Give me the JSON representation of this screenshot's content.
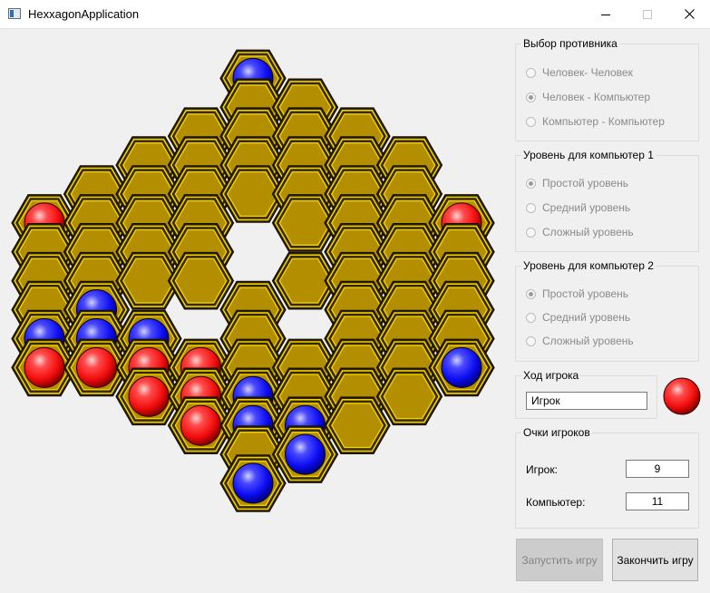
{
  "window": {
    "title": "HexxagonApplication"
  },
  "colors": {
    "board_fill": "#b38f00",
    "player_red": "#ff1a1a",
    "player_blue": "#1a1aff",
    "background": "#f0f0f0"
  },
  "board": {
    "cells": [
      {
        "col": 0,
        "row": 6,
        "piece": "red"
      },
      {
        "col": 0,
        "row": 7,
        "piece": "empty"
      },
      {
        "col": 0,
        "row": 8,
        "piece": "empty"
      },
      {
        "col": 0,
        "row": 9,
        "piece": "empty"
      },
      {
        "col": 0,
        "row": 10,
        "piece": "blue"
      },
      {
        "col": 0,
        "row": 11,
        "piece": "red"
      },
      {
        "col": 1,
        "row": 5,
        "piece": "empty"
      },
      {
        "col": 1,
        "row": 6,
        "piece": "empty"
      },
      {
        "col": 1,
        "row": 7,
        "piece": "empty"
      },
      {
        "col": 1,
        "row": 8,
        "piece": "empty"
      },
      {
        "col": 1,
        "row": 9,
        "piece": "blue"
      },
      {
        "col": 1,
        "row": 10,
        "piece": "blue"
      },
      {
        "col": 1,
        "row": 11,
        "piece": "red"
      },
      {
        "col": 2,
        "row": 4,
        "piece": "empty"
      },
      {
        "col": 2,
        "row": 5,
        "piece": "empty"
      },
      {
        "col": 2,
        "row": 6,
        "piece": "empty"
      },
      {
        "col": 2,
        "row": 7,
        "piece": "empty"
      },
      {
        "col": 2,
        "row": 8,
        "piece": "empty"
      },
      {
        "col": 2,
        "row": 10,
        "piece": "blue"
      },
      {
        "col": 2,
        "row": 11,
        "piece": "red"
      },
      {
        "col": 2,
        "row": 12,
        "piece": "red"
      },
      {
        "col": 3,
        "row": 3,
        "piece": "empty"
      },
      {
        "col": 3,
        "row": 4,
        "piece": "empty"
      },
      {
        "col": 3,
        "row": 5,
        "piece": "empty"
      },
      {
        "col": 3,
        "row": 6,
        "piece": "empty"
      },
      {
        "col": 3,
        "row": 7,
        "piece": "empty"
      },
      {
        "col": 3,
        "row": 8,
        "piece": "empty"
      },
      {
        "col": 3,
        "row": 11,
        "piece": "red"
      },
      {
        "col": 3,
        "row": 12,
        "piece": "red"
      },
      {
        "col": 3,
        "row": 13,
        "piece": "red"
      },
      {
        "col": 4,
        "row": 1,
        "piece": "blue"
      },
      {
        "col": 4,
        "row": 2,
        "piece": "empty"
      },
      {
        "col": 4,
        "row": 3,
        "piece": "empty"
      },
      {
        "col": 4,
        "row": 4,
        "piece": "empty"
      },
      {
        "col": 4,
        "row": 5,
        "piece": "empty"
      },
      {
        "col": 4,
        "row": 9,
        "piece": "empty"
      },
      {
        "col": 4,
        "row": 10,
        "piece": "empty"
      },
      {
        "col": 4,
        "row": 11,
        "piece": "empty"
      },
      {
        "col": 4,
        "row": 12,
        "piece": "blue"
      },
      {
        "col": 4,
        "row": 13,
        "piece": "blue"
      },
      {
        "col": 4,
        "row": 14,
        "piece": "empty"
      },
      {
        "col": 4,
        "row": 15,
        "piece": "blue"
      },
      {
        "col": 5,
        "row": 2,
        "piece": "empty"
      },
      {
        "col": 5,
        "row": 3,
        "piece": "empty"
      },
      {
        "col": 5,
        "row": 4,
        "piece": "empty"
      },
      {
        "col": 5,
        "row": 5,
        "piece": "empty"
      },
      {
        "col": 5,
        "row": 6,
        "piece": "empty"
      },
      {
        "col": 5,
        "row": 8,
        "piece": "empty"
      },
      {
        "col": 5,
        "row": 11,
        "piece": "empty"
      },
      {
        "col": 5,
        "row": 12,
        "piece": "empty"
      },
      {
        "col": 5,
        "row": 13,
        "piece": "blue"
      },
      {
        "col": 5,
        "row": 14,
        "piece": "blue"
      },
      {
        "col": 6,
        "row": 3,
        "piece": "empty"
      },
      {
        "col": 6,
        "row": 4,
        "piece": "empty"
      },
      {
        "col": 6,
        "row": 5,
        "piece": "empty"
      },
      {
        "col": 6,
        "row": 6,
        "piece": "empty"
      },
      {
        "col": 6,
        "row": 7,
        "piece": "empty"
      },
      {
        "col": 6,
        "row": 8,
        "piece": "empty"
      },
      {
        "col": 6,
        "row": 9,
        "piece": "empty"
      },
      {
        "col": 6,
        "row": 10,
        "piece": "empty"
      },
      {
        "col": 6,
        "row": 11,
        "piece": "empty"
      },
      {
        "col": 6,
        "row": 12,
        "piece": "empty"
      },
      {
        "col": 6,
        "row": 13,
        "piece": "empty"
      },
      {
        "col": 7,
        "row": 4,
        "piece": "empty"
      },
      {
        "col": 7,
        "row": 5,
        "piece": "empty"
      },
      {
        "col": 7,
        "row": 6,
        "piece": "empty"
      },
      {
        "col": 7,
        "row": 7,
        "piece": "empty"
      },
      {
        "col": 7,
        "row": 8,
        "piece": "empty"
      },
      {
        "col": 7,
        "row": 9,
        "piece": "empty"
      },
      {
        "col": 7,
        "row": 10,
        "piece": "empty"
      },
      {
        "col": 7,
        "row": 11,
        "piece": "empty"
      },
      {
        "col": 7,
        "row": 12,
        "piece": "empty"
      },
      {
        "col": 8,
        "row": 6,
        "piece": "red"
      },
      {
        "col": 8,
        "row": 7,
        "piece": "empty"
      },
      {
        "col": 8,
        "row": 8,
        "piece": "empty"
      },
      {
        "col": 8,
        "row": 9,
        "piece": "empty"
      },
      {
        "col": 8,
        "row": 10,
        "piece": "empty"
      },
      {
        "col": 8,
        "row": 11,
        "piece": "blue"
      }
    ]
  },
  "opponent_group": {
    "title": "Выбор противника",
    "options": [
      {
        "label": "Человек- Человек",
        "checked": false
      },
      {
        "label": "Человек - Компьютер",
        "checked": true
      },
      {
        "label": "Компьютер - Компьютер",
        "checked": false
      }
    ]
  },
  "level1_group": {
    "title": "Уровень для компьютер 1",
    "options": [
      {
        "label": "Простой уровень",
        "checked": true
      },
      {
        "label": "Средний уровень",
        "checked": false
      },
      {
        "label": "Сложный уровень",
        "checked": false
      }
    ]
  },
  "level2_group": {
    "title": "Уровень для компьютер 2",
    "options": [
      {
        "label": "Простой уровень",
        "checked": true
      },
      {
        "label": "Средний уровень",
        "checked": false
      },
      {
        "label": "Сложный уровень",
        "checked": false
      }
    ]
  },
  "turn_group": {
    "title": "Ход игрока",
    "value": "Игрок",
    "current_color": "red"
  },
  "score_group": {
    "title": "Очки игроков",
    "player_label": "Игрок:",
    "player_score": "9",
    "computer_label": "Компьютер:",
    "computer_score": "11"
  },
  "buttons": {
    "start": "Запустить игру",
    "stop": "Закончить игру"
  }
}
